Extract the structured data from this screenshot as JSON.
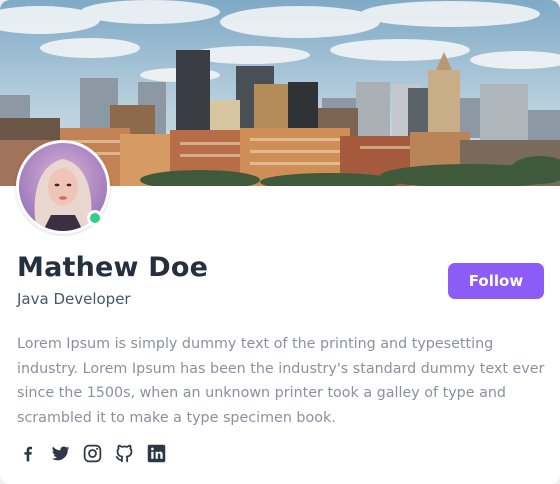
{
  "profile": {
    "name": "Mathew Doe",
    "role": "Java Developer",
    "bio": "Lorem Ipsum is simply dummy text of the printing and typesetting industry. Lorem Ipsum has been the industry's standard dummy text ever since the 1500s, when an unknown printer took a galley of type and scrambled it to make a type specimen book.",
    "status": "online"
  },
  "actions": {
    "follow_label": "Follow"
  },
  "socials": [
    {
      "icon": "facebook-icon"
    },
    {
      "icon": "twitter-icon"
    },
    {
      "icon": "instagram-icon"
    },
    {
      "icon": "github-icon"
    },
    {
      "icon": "linkedin-icon"
    }
  ],
  "colors": {
    "accent": "#8b5cf6",
    "online": "#2fd08a",
    "name_text": "#252f3f",
    "bio_text": "#8a919d",
    "icon": "#2d3748"
  }
}
